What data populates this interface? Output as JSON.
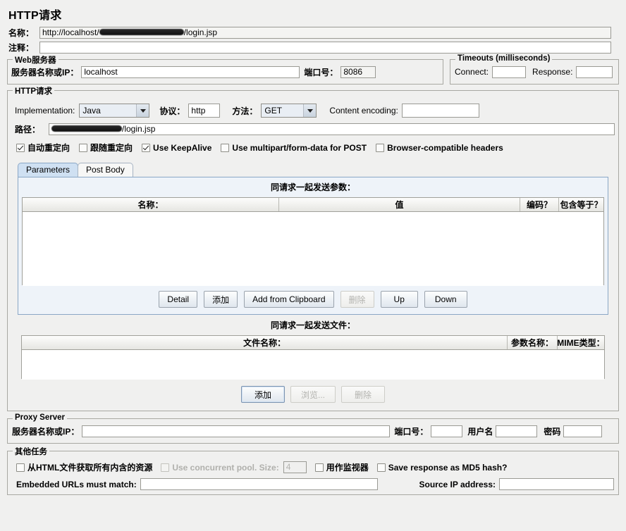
{
  "page_title": "HTTP请求",
  "top_fields": {
    "name_label": "名称：",
    "name_value_prefix": "http://localhost/",
    "name_value_suffix": "/login.jsp",
    "name_redacted": true,
    "comment_label": "注释：",
    "comment_value": ""
  },
  "web_server": {
    "title": "Web服务器",
    "server_label": "服务器名称或IP：",
    "server_value": "localhost",
    "port_label": "端口号：",
    "port_value": "8086"
  },
  "timeouts": {
    "title": "Timeouts (milliseconds)",
    "connect_label": "Connect:",
    "connect_value": "",
    "response_label": "Response:",
    "response_value": ""
  },
  "http_request": {
    "title": "HTTP请求",
    "implementation_label": "Implementation:",
    "implementation_value": "Java",
    "protocol_label": "协议：",
    "protocol_value": "http",
    "method_label": "方法：",
    "method_value": "GET",
    "content_encoding_label": "Content encoding:",
    "content_encoding_value": "",
    "path_label": "路径：",
    "path_value_suffix": "/login.jsp",
    "path_redacted": true,
    "checkboxes": [
      {
        "label": "自动重定向",
        "checked": true,
        "disabled": false
      },
      {
        "label": "跟随重定向",
        "checked": false,
        "disabled": false
      },
      {
        "label": "Use KeepAlive",
        "checked": true,
        "disabled": false
      },
      {
        "label": "Use multipart/form-data for POST",
        "checked": false,
        "disabled": false
      },
      {
        "label": "Browser-compatible headers",
        "checked": false,
        "disabled": false
      }
    ]
  },
  "tabs": [
    {
      "label": "Parameters",
      "active": true
    },
    {
      "label": "Post Body",
      "active": false
    }
  ],
  "params_panel": {
    "caption": "同请求一起发送参数：",
    "columns": [
      "名称：",
      "值",
      "编码？",
      "包含等于？"
    ],
    "rows": [],
    "buttons": [
      {
        "label": "Detail",
        "disabled": false,
        "focused": false
      },
      {
        "label": "添加",
        "disabled": false,
        "focused": false
      },
      {
        "label": "Add from Clipboard",
        "disabled": false,
        "focused": false
      },
      {
        "label": "删除",
        "disabled": true,
        "focused": false
      },
      {
        "label": "Up",
        "disabled": false,
        "focused": false
      },
      {
        "label": "Down",
        "disabled": false,
        "focused": false
      }
    ]
  },
  "files_panel": {
    "caption": "同请求一起发送文件：",
    "columns": [
      "文件名称：",
      "参数名称：",
      "MIME类型："
    ],
    "rows": [],
    "buttons": [
      {
        "label": "添加",
        "disabled": false,
        "focused": true
      },
      {
        "label": "浏览...",
        "disabled": true,
        "focused": false
      },
      {
        "label": "删除",
        "disabled": true,
        "focused": false
      }
    ]
  },
  "proxy_server": {
    "title": "Proxy Server",
    "server_label": "服务器名称或IP：",
    "server_value": "",
    "port_label": "端口号：",
    "port_value": "",
    "username_label": "用户名",
    "username_value": "",
    "password_label": "密码",
    "password_value": ""
  },
  "other_tasks": {
    "title": "其他任务",
    "checkboxes": [
      {
        "label": "从HTML文件获取所有内含的资源",
        "checked": false,
        "disabled": false
      },
      {
        "label": "Use concurrent pool. Size:",
        "checked": false,
        "disabled": true
      },
      {
        "label": "用作监视器",
        "checked": false,
        "disabled": false
      },
      {
        "label": "Save response as MD5 hash?",
        "checked": false,
        "disabled": false
      }
    ],
    "pool_size_value": "4",
    "pool_size_disabled": true,
    "embedded_urls_label": "Embedded URLs must match:",
    "embedded_urls_value": "",
    "source_ip_label": "Source IP address:",
    "source_ip_value": ""
  },
  "colors": {
    "background": "#f0f0ef",
    "tab_active": "#cfe0f2",
    "panel": "#eef3f9",
    "border": "#a8a8a2"
  }
}
